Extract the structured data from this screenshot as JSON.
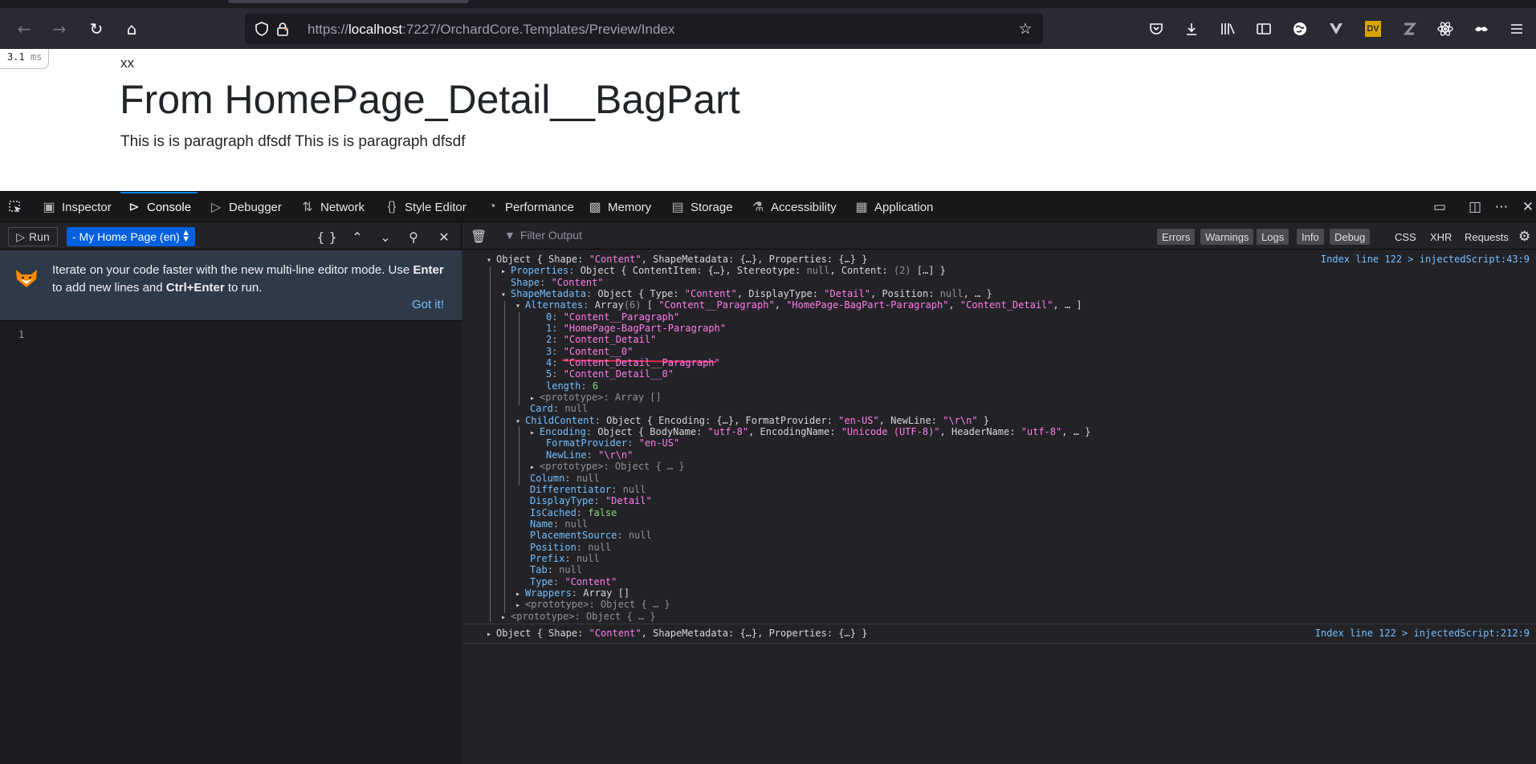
{
  "browser": {
    "url_prefix": "https://",
    "url_host": "localhost",
    "url_rest": ":7227/OrchardCore.Templates/Preview/Index",
    "extension_badge": "DV"
  },
  "page": {
    "timing_value": "3.1",
    "timing_unit": "ms",
    "small_text": "xx",
    "heading": "From HomePage_Detail__BagPart",
    "paragraph": "This is is paragraph dfsdf This is is paragraph dfsdf"
  },
  "devtools": {
    "tabs": [
      {
        "label": "Inspector"
      },
      {
        "label": "Console"
      },
      {
        "label": "Debugger"
      },
      {
        "label": "Network"
      },
      {
        "label": "Style Editor"
      },
      {
        "label": "Performance"
      },
      {
        "label": "Memory"
      },
      {
        "label": "Storage"
      },
      {
        "label": "Accessibility"
      },
      {
        "label": "Application"
      }
    ],
    "selected_tab": "Console",
    "editor": {
      "run_label": "Run",
      "context": "- My Home Page (en)",
      "notice_part1": "Iterate on your code faster with the new multi-line editor mode. Use ",
      "notice_enter": "Enter",
      "notice_part2": " to add new lines and ",
      "notice_ctrl": "Ctrl+Enter",
      "notice_part3": " to run.",
      "got_it": "Got it!",
      "line_number": "1"
    },
    "output": {
      "filter_placeholder": "Filter Output",
      "filters": [
        "Errors",
        "Warnings",
        "Logs",
        "Info",
        "Debug",
        "CSS",
        "XHR",
        "Requests"
      ],
      "source1": "Index line 122 > injectedScript:43:9",
      "source2": "Index line 122 > injectedScript:212:9"
    }
  },
  "colors": {
    "accent": "#0a84ff",
    "selector_bg": "#0060df",
    "string": "#ff7de9",
    "key": "#75bfff",
    "underline": "#e22850"
  }
}
